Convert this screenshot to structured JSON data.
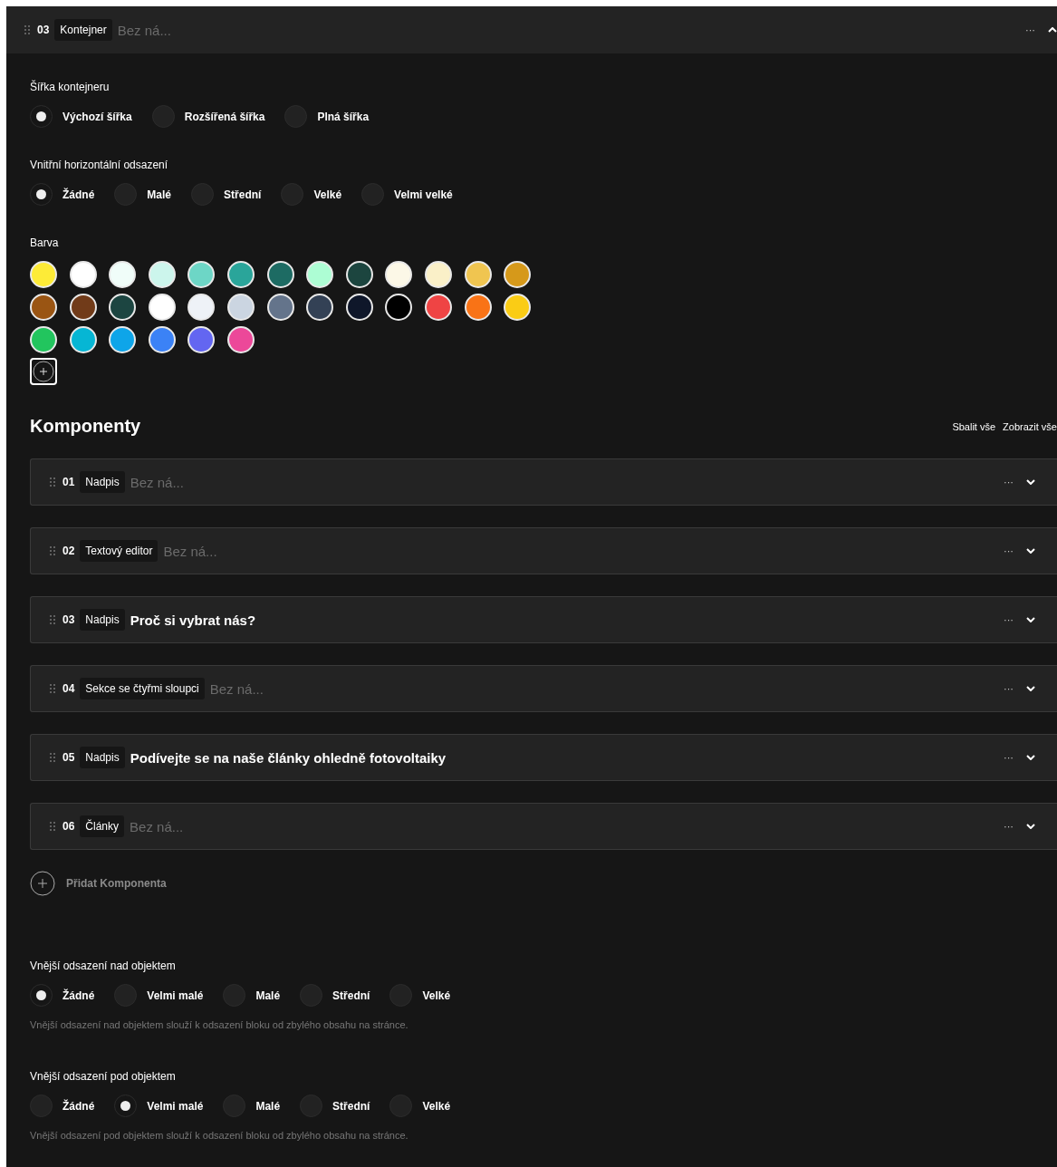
{
  "header": {
    "number": "03",
    "tag": "Kontejner",
    "placeholder": "Bez ná...",
    "menu": "···",
    "expanded": true
  },
  "width_group": {
    "label": "Šířka kontejneru",
    "options": [
      {
        "label": "Výchozí šířka",
        "selected": true
      },
      {
        "label": "Rozšířená šířka",
        "selected": false
      },
      {
        "label": "Plná šířka",
        "selected": false
      }
    ]
  },
  "padding_group": {
    "label": "Vnitřní horizontální odsazení",
    "options": [
      {
        "label": "Žádné",
        "selected": true
      },
      {
        "label": "Malé",
        "selected": false
      },
      {
        "label": "Střední",
        "selected": false
      },
      {
        "label": "Velké",
        "selected": false
      },
      {
        "label": "Velmi velké",
        "selected": false
      }
    ]
  },
  "color_group": {
    "label": "Barva",
    "swatches": [
      {
        "color": "#fdeb37"
      },
      {
        "color": "#ffffff"
      },
      {
        "color": "#f0fdf9"
      },
      {
        "color": "#ccf5ec"
      },
      {
        "color": "#6dd6c6"
      },
      {
        "color": "#2aa59a"
      },
      {
        "color": "#1d6b63"
      },
      {
        "color": "#adfdd4"
      },
      {
        "color": "#1c453f"
      },
      {
        "color": "#fcf8e7"
      },
      {
        "color": "#faf0c8"
      },
      {
        "color": "#f0c550"
      },
      {
        "color": "#d6991a"
      },
      {
        "color": "#9a5513"
      },
      {
        "color": "#713b19"
      },
      {
        "color": "#1c4541"
      },
      {
        "color": "#ffffff"
      },
      {
        "color": "#eef2f7"
      },
      {
        "color": "#cbd5e1"
      },
      {
        "color": "#64748b"
      },
      {
        "color": "#334155"
      },
      {
        "color": "#0f172a"
      },
      {
        "color": "#000000"
      },
      {
        "color": "#ef4444"
      },
      {
        "color": "#f97316"
      },
      {
        "color": "#facc15"
      },
      {
        "color": "#22c55e"
      },
      {
        "color": "#06b6d4"
      },
      {
        "color": "#0ea5e9"
      },
      {
        "color": "#3b82f6"
      },
      {
        "color": "#6366f1"
      },
      {
        "color": "#ec4899"
      }
    ]
  },
  "components": {
    "title": "Komponenty",
    "actions": [
      "Sbalit vše",
      "Zobrazit vše"
    ],
    "items": [
      {
        "number": "01",
        "tag": "Nadpis",
        "placeholder": "Bez ná...",
        "menu": "···",
        "expanded": false
      },
      {
        "number": "02",
        "tag": "Textový editor",
        "placeholder": "Bez ná...",
        "menu": "···",
        "expanded": false
      },
      {
        "number": "03",
        "tag": "Nadpis",
        "title": "Proč si vybrat nás?",
        "menu": "···",
        "expanded": false
      },
      {
        "number": "04",
        "tag": "Sekce se čtyřmi sloupci",
        "placeholder": "Bez ná...",
        "menu": "···",
        "expanded": false
      },
      {
        "number": "05",
        "tag": "Nadpis",
        "title": "Podívejte se na naše články ohledně fotovoltaiky",
        "menu": "···",
        "expanded": false
      },
      {
        "number": "06",
        "tag": "Články",
        "placeholder": "Bez ná...",
        "menu": "···",
        "expanded": false
      }
    ],
    "add_label": "Přidat Komponenta"
  },
  "margin_groups": [
    {
      "label": "Vnější odsazení nad objektem",
      "options": [
        {
          "label": "Žádné",
          "selected": true
        },
        {
          "label": "Velmi malé",
          "selected": false
        },
        {
          "label": "Malé",
          "selected": false
        },
        {
          "label": "Střední",
          "selected": false
        },
        {
          "label": "Velké",
          "selected": false
        }
      ],
      "help": "Vnější odsazení nad objektem slouží k odsazení bloku od zbylého obsahu na stránce."
    },
    {
      "label": "Vnější odsazení pod objektem",
      "options": [
        {
          "label": "Žádné",
          "selected": false
        },
        {
          "label": "Velmi malé",
          "selected": true
        },
        {
          "label": "Malé",
          "selected": false
        },
        {
          "label": "Střední",
          "selected": false
        },
        {
          "label": "Velké",
          "selected": false
        }
      ],
      "help": "Vnější odsazení pod objektem slouží k odsazení bloku od zbylého obsahu na stránce."
    }
  ]
}
